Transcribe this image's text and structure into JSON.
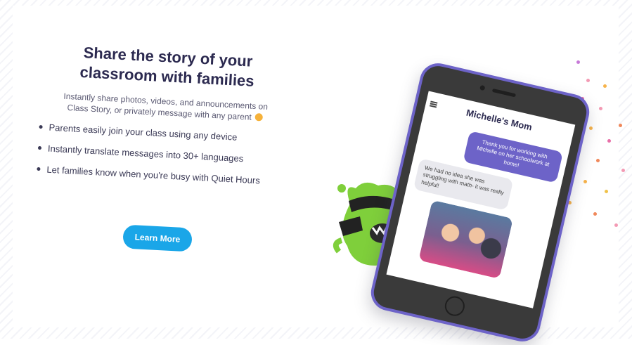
{
  "headline": {
    "line1": "Share the story of your",
    "line2": "classroom with families"
  },
  "intro": {
    "line1": "Instantly share photos, videos, and announcements on",
    "line2": "Class Story, or privately message with any parent"
  },
  "bullets": [
    "Parents easily join your class using any device",
    "Instantly translate messages into 30+ languages",
    "Let families know when you're busy with Quiet Hours"
  ],
  "cta": {
    "label": "Learn More"
  },
  "phone": {
    "chat_title": "Michelle's Mom",
    "messages": [
      "Thank you for working with Michelle on her schoolwork at home!",
      "We had no idea she was struggling with math- it was really helpful!"
    ]
  },
  "colors": {
    "accent": "#1aa6e8",
    "brand_purple": "#6d63c8",
    "monster_green": "#7fcf3b"
  }
}
